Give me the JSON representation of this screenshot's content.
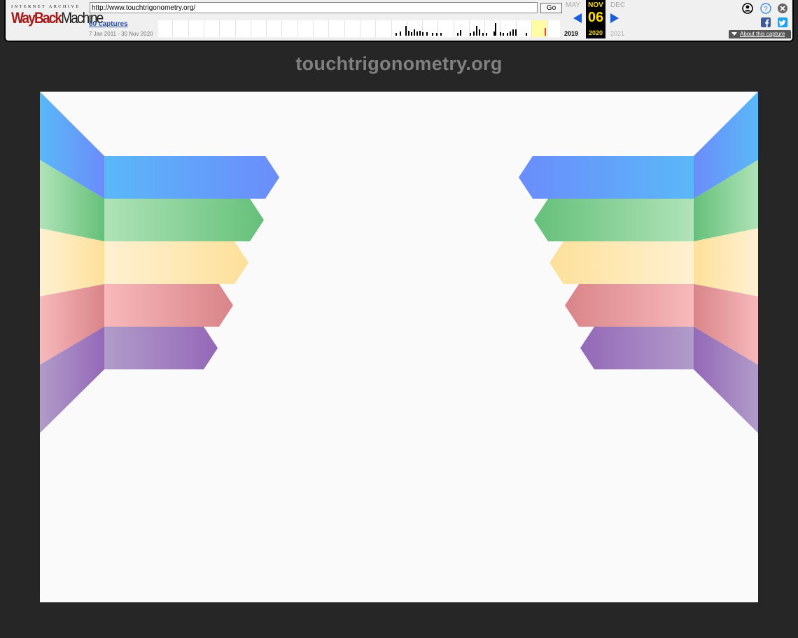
{
  "wayback": {
    "logo_top": "INTERNET ARCHIVE",
    "logo_way": "WayBack",
    "logo_machine": "Machine",
    "url": "http://www.touchtrigonometry.org/",
    "go_label": "Go",
    "captures_label": "60 captures",
    "captures_range": "7 Jan 2011 - 30 Nov 2020",
    "prev_month": "MAY",
    "current_month": "NOV",
    "next_month": "DEC",
    "current_day": "06",
    "prev_year": "2019",
    "current_year": "2020",
    "next_year": "2021",
    "about_label": "About this capture",
    "accent": "#1c5dd6",
    "highlight": "#ffde00"
  },
  "page": {
    "site_title": "touchtrigonometry.org",
    "background": "#262626",
    "canvas_background": "#fafafa"
  },
  "graphic": {
    "bands": [
      {
        "name": "blue",
        "dark": "#6b8cfa",
        "light": "#5ab8f8"
      },
      {
        "name": "green",
        "dark": "#65c07a",
        "light": "#b0e3b8"
      },
      {
        "name": "yellow",
        "dark": "#fde09a",
        "light": "#fef1d2"
      },
      {
        "name": "red",
        "dark": "#d98488",
        "light": "#f7b9bb"
      },
      {
        "name": "purple",
        "dark": "#9468b8",
        "light": "#b09cc8"
      }
    ]
  }
}
